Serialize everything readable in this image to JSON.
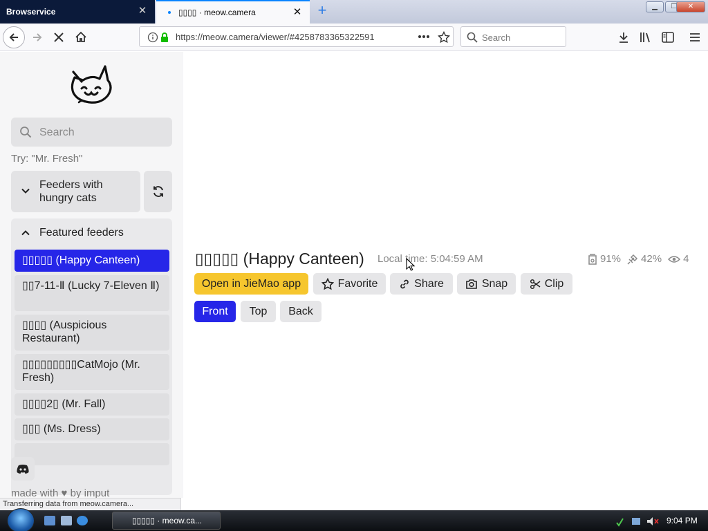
{
  "browser": {
    "tabs": [
      {
        "title": "Browservice",
        "active": false
      },
      {
        "title": "▯▯▯▯ · meow.camera",
        "active": true
      }
    ],
    "url": "https://meow.camera/viewer/#4258783365322591",
    "search_placeholder": "Search",
    "status_text": "Transferring data from meow.camera..."
  },
  "sidebar": {
    "search_placeholder": "Search",
    "try_hint": "Try: \"Mr. Fresh\"",
    "feeder_select_label": "Feeders with hungry cats",
    "featured_header": "Featured feeders",
    "feeders": [
      {
        "label": "▯▯▯▯▯ (Happy Canteen)",
        "selected": true
      },
      {
        "label": "▯▯7-11-Ⅱ (Lucky 7-Eleven Ⅱ)",
        "selected": false
      },
      {
        "label": "▯▯▯▯ (Auspicious Restaurant)",
        "selected": false
      },
      {
        "label": "▯▯▯▯▯▯▯▯▯CatMojo (Mr. Fresh)",
        "selected": false
      },
      {
        "label": "▯▯▯▯2▯ (Mr. Fall)",
        "selected": false
      },
      {
        "label": "▯▯▯ (Ms. Dress)",
        "selected": false
      }
    ],
    "footer_text": "made with ♥ by imput"
  },
  "viewer": {
    "title": "▯▯▯▯▯ (Happy Canteen)",
    "local_time": "Local time: 5:04:59 AM",
    "stats": {
      "food": "91%",
      "battery": "42%",
      "viewers": "4"
    },
    "actions": {
      "open_app": "Open in JieMao app",
      "favorite": "Favorite",
      "share": "Share",
      "snap": "Snap",
      "clip": "Clip"
    },
    "views": [
      {
        "label": "Front",
        "selected": true
      },
      {
        "label": "Top",
        "selected": false
      },
      {
        "label": "Back",
        "selected": false
      }
    ]
  },
  "taskbar": {
    "task_label": "▯▯▯▯▯ · meow.ca...",
    "clock": "9:04 PM"
  },
  "colors": {
    "accent": "#2626e8",
    "open_app": "#f6c62e",
    "secure": "#12bc00"
  }
}
